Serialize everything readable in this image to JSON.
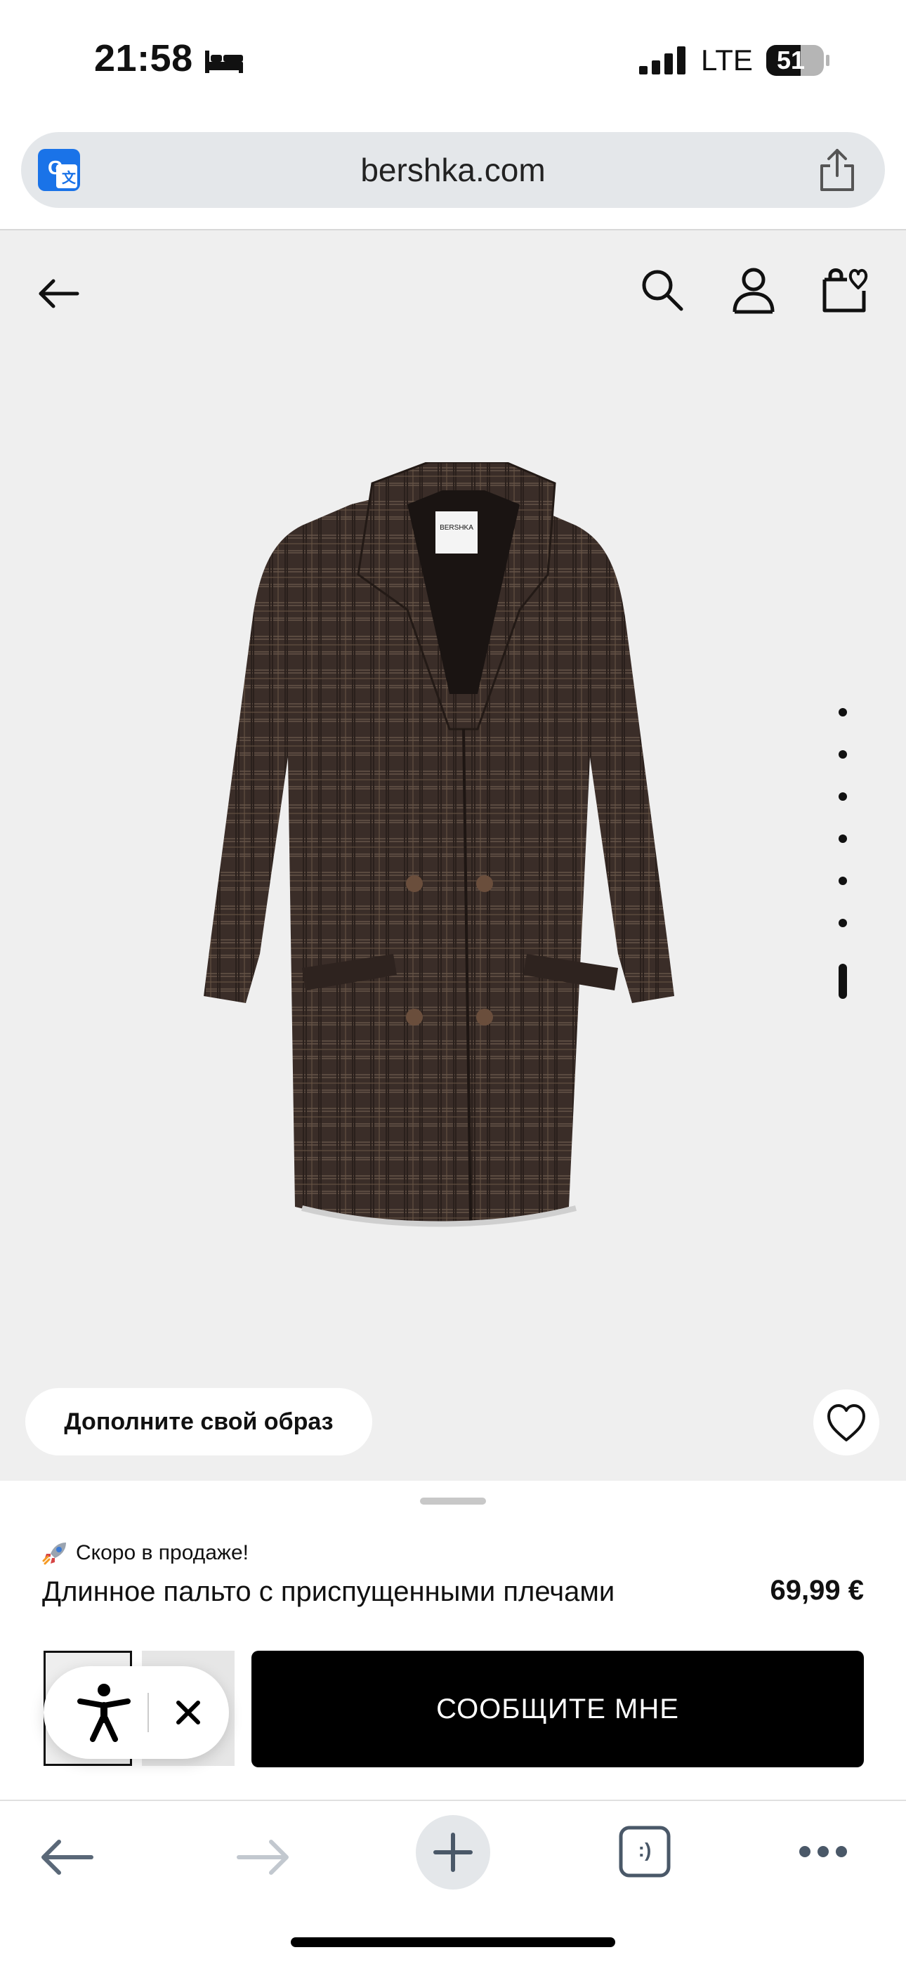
{
  "status_bar": {
    "time": "21:58",
    "network": "LTE",
    "battery": "51"
  },
  "browser": {
    "url": "bershka.com"
  },
  "product": {
    "complete_look_label": "Дополните свой образ",
    "soon_label": "Скоро в продаже!",
    "title": "Длинное пальто с приспущенными плечами",
    "price": "69,99 €",
    "notify_button_label": "СООБЩИТЕ МНЕ",
    "gallery_dots_count": 7,
    "gallery_active_index": 7,
    "accent_color": "#000000"
  },
  "tabs_button_label": ":)"
}
